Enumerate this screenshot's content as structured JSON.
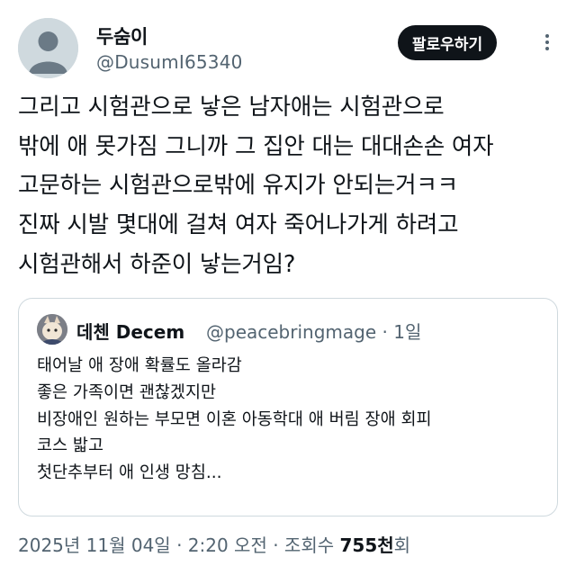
{
  "author": {
    "name": "두숨이",
    "handle": "@DusumI65340",
    "avatar_icon": "default-avatar-icon"
  },
  "follow_button": {
    "label": "팔로우하기"
  },
  "more_icon": "more-dots-icon",
  "tweet": {
    "lines": [
      "그리고 시험관으로 낳은 남자애는 시험관으로",
      "밖에 애 못가짐 그니까 그 집안 대는 대대손손 여자",
      "고문하는 시험관으로밖에 유지가 안되는거ㅋㅋ",
      "진짜 시발 몇대에 걸쳐 여자 죽어나가게 하려고",
      "시험관해서 하준이 낳는거임?"
    ]
  },
  "quoted": {
    "name": "데첸 Decem",
    "handle_and_time": "@peacebringmage · 1일",
    "lines": [
      "태어날 애 장애 확률도 올라감",
      "좋은 가족이면 괜찮겠지만",
      "비장애인 원하는 부모면 이혼 아동학대 애 버림 장애 회피",
      "코스 밟고",
      "첫단추부터 애 인생 망침..."
    ]
  },
  "meta": {
    "timestamp": "2025년 11월 04일 · 2:20 오전 · 조회수 ",
    "views": "755천",
    "views_suffix": "회"
  },
  "colors": {
    "text": "#0f1419",
    "secondary": "#536471",
    "border": "#cfd9de",
    "button_bg": "#0f1419"
  }
}
